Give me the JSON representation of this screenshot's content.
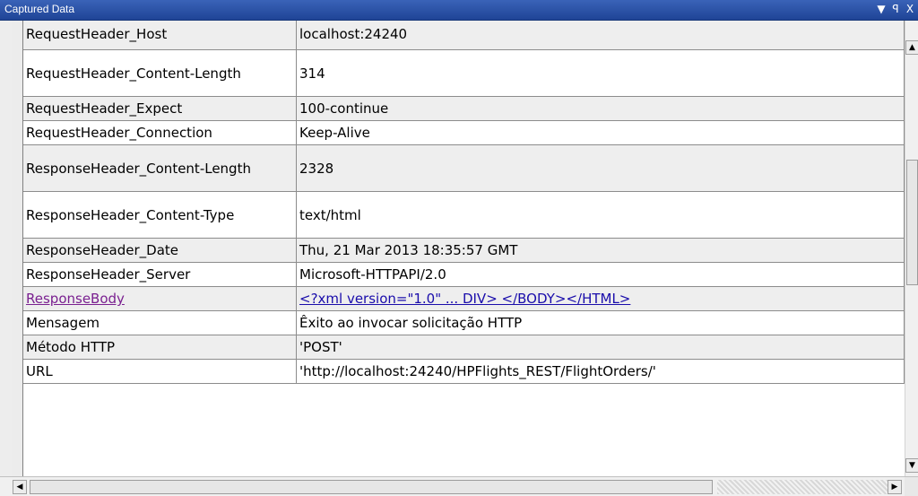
{
  "window": {
    "title": "Captured Data",
    "controls": {
      "dropdown": "▼",
      "pin": "ꟼ",
      "close": "X"
    }
  },
  "rows": [
    {
      "key": "RequestHeader_Host",
      "value": "localhost:24240"
    },
    {
      "key": "RequestHeader_Content-Length",
      "value": "314"
    },
    {
      "key": "RequestHeader_Expect",
      "value": "100-continue"
    },
    {
      "key": "RequestHeader_Connection",
      "value": "Keep-Alive"
    },
    {
      "key": "ResponseHeader_Content-Length",
      "value": "2328"
    },
    {
      "key": "ResponseHeader_Content-Type",
      "value": "text/html"
    },
    {
      "key": "ResponseHeader_Date",
      "value": "Thu, 21 Mar 2013 18:35:57 GMT"
    },
    {
      "key": "ResponseHeader_Server",
      "value": "Microsoft-HTTPAPI/2.0"
    },
    {
      "key": "ResponseBody",
      "value": "<?xml version=\"1.0\" ... DIV> </BODY></HTML>"
    },
    {
      "key": "Mensagem",
      "value": "Êxito ao invocar solicitação HTTP"
    },
    {
      "key": "Método HTTP",
      "value": "'POST'"
    },
    {
      "key": "URL",
      "value": "'http://localhost:24240/HPFlights_REST/FlightOrders/'"
    }
  ],
  "colors": {
    "titlebar": "#1f4496",
    "link": "#1a0dab",
    "visited_link": "#7a2090",
    "alt_row": "#eeeeee"
  }
}
